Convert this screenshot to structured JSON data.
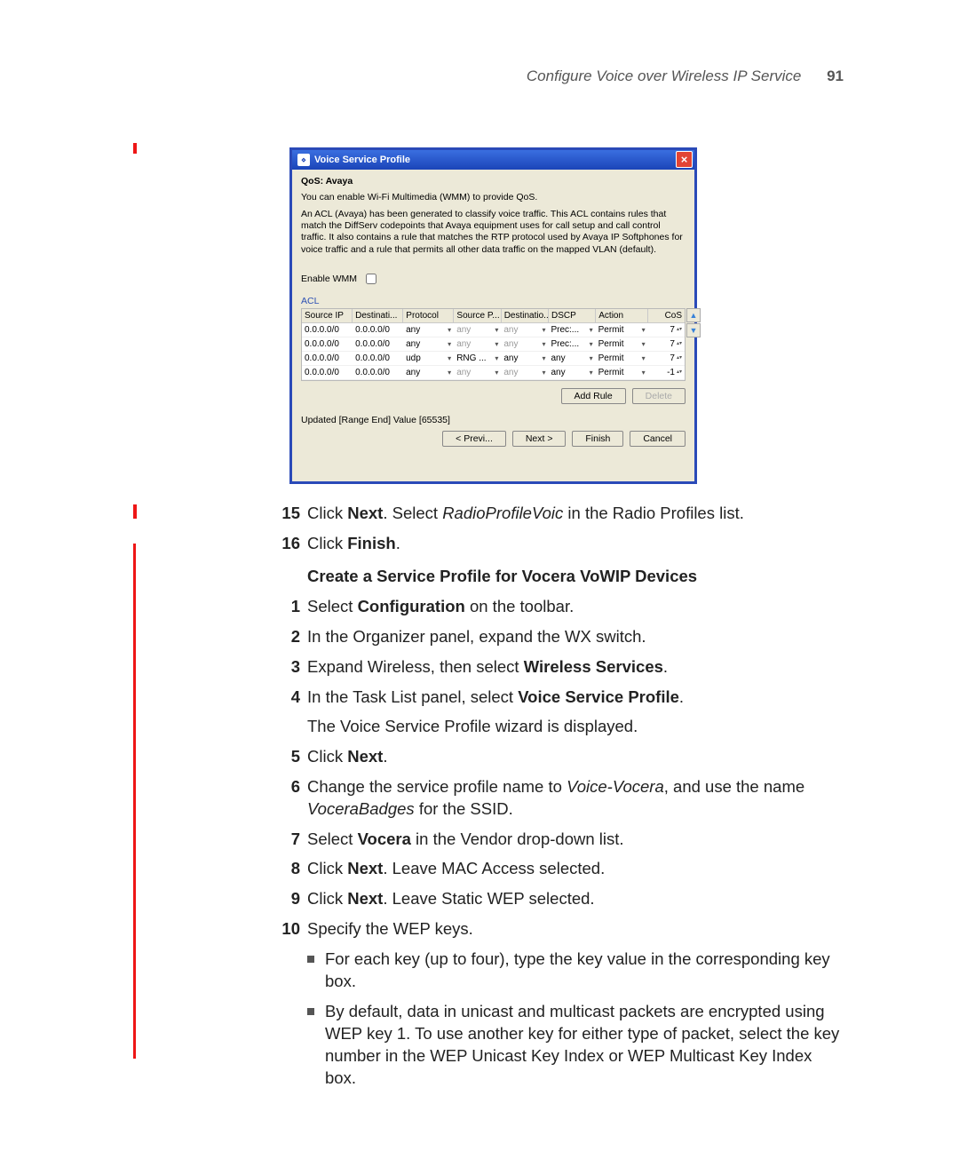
{
  "header": {
    "section": "Configure Voice over Wireless IP Service",
    "page": "91"
  },
  "dialog": {
    "title": "Voice Service Profile",
    "close_char": "×",
    "qos_title": "QoS: Avaya",
    "line1": "You can enable Wi-Fi Multimedia (WMM) to provide QoS.",
    "line2": "An ACL (Avaya) has been generated to classify voice traffic. This ACL contains rules that match the DiffServ codepoints that Avaya equipment uses for call setup and call control traffic. It also contains a rule that matches the RTP protocol used by Avaya IP Softphones for voice traffic and a rule that permits all other data traffic on the mapped VLAN (default).",
    "enable_label": "Enable WMM",
    "acl_label": "ACL",
    "columns": {
      "c1": "Source IP",
      "c2": "Destinati...",
      "c3": "Protocol",
      "c4": "Source P...",
      "c5": "Destinatio...",
      "c6": "DSCP",
      "c7": "Action",
      "c8": "CoS"
    },
    "rows": [
      {
        "sip": "0.0.0.0/0",
        "dip": "0.0.0.0/0",
        "proto": "any",
        "sp": "any",
        "sp_gray": true,
        "dp": "any",
        "dp_gray": true,
        "dscp": "Prec:...",
        "act": "Permit",
        "cos": "7"
      },
      {
        "sip": "0.0.0.0/0",
        "dip": "0.0.0.0/0",
        "proto": "any",
        "sp": "any",
        "sp_gray": true,
        "dp": "any",
        "dp_gray": true,
        "dscp": "Prec:...",
        "act": "Permit",
        "cos": "7"
      },
      {
        "sip": "0.0.0.0/0",
        "dip": "0.0.0.0/0",
        "proto": "udp",
        "sp": "RNG ...",
        "sp_gray": false,
        "dp": "any",
        "dp_gray": false,
        "dscp": "any",
        "act": "Permit",
        "cos": "7"
      },
      {
        "sip": "0.0.0.0/0",
        "dip": "0.0.0.0/0",
        "proto": "any",
        "sp": "any",
        "sp_gray": true,
        "dp": "any",
        "dp_gray": true,
        "dscp": "any",
        "act": "Permit",
        "cos": "-1"
      }
    ],
    "add_rule": "Add Rule",
    "delete": "Delete",
    "status": "Updated [Range End] Value [65535]",
    "prev": "< Previ...",
    "next": "Next >",
    "finish": "Finish",
    "cancel": "Cancel"
  },
  "steps_upper": [
    {
      "n": "15",
      "pre": "Click ",
      "b": "Next",
      "mid": ". Select ",
      "i": "RadioProfileVoic",
      "post": " in the Radio Profiles list."
    },
    {
      "n": "16",
      "pre": "Click ",
      "b": "Finish",
      "post": "."
    }
  ],
  "section_heading": "Create a Service Profile for Vocera VoWIP Devices",
  "step1": {
    "n": "1",
    "pre": "Select ",
    "b": "Configuration",
    "post": " on the toolbar."
  },
  "step2": {
    "n": "2",
    "text": "In the Organizer panel, expand the WX switch."
  },
  "step3": {
    "n": "3",
    "pre": "Expand Wireless, then select ",
    "b": "Wireless Services",
    "post": "."
  },
  "step4": {
    "n": "4",
    "pre": "In the Task List panel, select ",
    "b": "Voice Service Profile",
    "post": "."
  },
  "step4_sub": "The Voice Service Profile wizard is displayed.",
  "step5": {
    "n": "5",
    "pre": "Click ",
    "b": "Next",
    "post": "."
  },
  "step6": {
    "n": "6",
    "pre": "Change the service profile name to ",
    "i1": "Voice-Vocera",
    "mid": ", and use the name ",
    "i2": "VoceraBadges",
    "post": " for the SSID."
  },
  "step7": {
    "n": "7",
    "pre": "Select ",
    "b": "Vocera",
    "post": " in the Vendor drop-down list."
  },
  "step8": {
    "n": "8",
    "pre": "Click ",
    "b": "Next",
    "post": ". Leave MAC Access selected."
  },
  "step9": {
    "n": "9",
    "pre": "Click ",
    "b": "Next",
    "post": ". Leave Static WEP selected."
  },
  "step10": {
    "n": "10",
    "text": "Specify the WEP keys."
  },
  "bullet1": "For each key (up to four), type the key value in the corresponding key box.",
  "bullet2": "By default, data in unicast and multicast packets are encrypted using WEP key 1. To use another key for either type of packet, select the key number in the WEP Unicast Key Index or WEP Multicast Key Index box."
}
